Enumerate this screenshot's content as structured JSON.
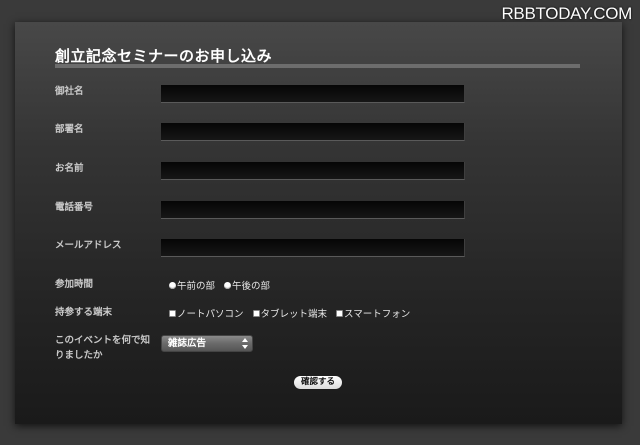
{
  "watermark": "RBBTODAY.COM",
  "form": {
    "title": "創立記念セミナーのお申し込み",
    "fields": [
      {
        "label": "御社名",
        "value": ""
      },
      {
        "label": "部署名",
        "value": ""
      },
      {
        "label": "お名前",
        "value": ""
      },
      {
        "label": "電話番号",
        "value": ""
      },
      {
        "label": "メールアドレス",
        "value": ""
      }
    ],
    "attend_time": {
      "label": "参加時間",
      "options": [
        "午前の部",
        "午後の部"
      ]
    },
    "devices": {
      "label": "持参する端末",
      "options": [
        "ノートパソコン",
        "タブレット端末",
        "スマートフォン"
      ]
    },
    "source": {
      "label_line1": "このイベントを何で知",
      "label_line2": "りましたか",
      "selected": "雑誌広告"
    },
    "confirm_label": "確認する"
  },
  "colors": {
    "background": "#3a3a3a",
    "panel_top": "#484848",
    "panel_bottom": "#1a1a1a",
    "field": "#0a0a0a",
    "label": "#c9c9c9",
    "title": "#ffffff"
  }
}
